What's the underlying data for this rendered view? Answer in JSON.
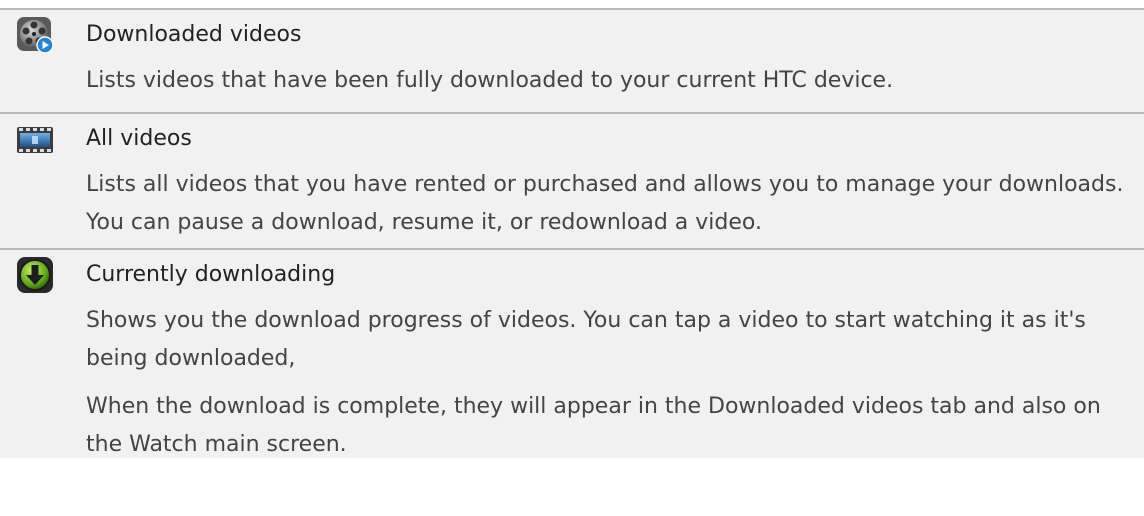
{
  "rows": [
    {
      "icon": "film-reel-play-icon",
      "title": "Downloaded videos",
      "paragraphs": [
        "Lists videos that have been fully downloaded to your current HTC device."
      ]
    },
    {
      "icon": "film-strip-icon",
      "title": "All videos",
      "paragraphs": [
        "Lists all videos that you have rented or purchased and allows you to manage your downloads. You can pause a download, resume it, or redownload a video."
      ]
    },
    {
      "icon": "download-arrow-icon",
      "title": "Currently downloading",
      "paragraphs": [
        "Shows you the download progress of videos. You can tap a video to start watching it as it's being downloaded,",
        "When the download is complete, they will appear in the Downloaded videos tab and also on the Watch main screen."
      ]
    }
  ]
}
